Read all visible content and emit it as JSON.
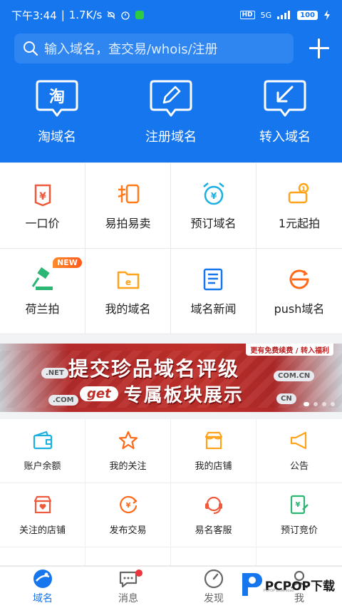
{
  "status_bar": {
    "time": "下午3:44",
    "speed": "1.7K/s",
    "hd": "HD",
    "network": "5G",
    "battery": "100"
  },
  "search": {
    "placeholder": "输入域名，查交易/whois/注册"
  },
  "quick_actions": [
    {
      "label": "淘域名",
      "icon": "tao-domain-icon"
    },
    {
      "label": "注册域名",
      "icon": "pencil-register-icon"
    },
    {
      "label": "转入域名",
      "icon": "transfer-in-icon"
    }
  ],
  "features": [
    {
      "label": "一口价",
      "icon": "price-tag-icon"
    },
    {
      "label": "易拍易卖",
      "icon": "auction-card-icon"
    },
    {
      "label": "预订域名",
      "icon": "alarm-clock-icon"
    },
    {
      "label": "1元起拍",
      "icon": "coin-stack-icon"
    },
    {
      "label": "荷兰拍",
      "icon": "gavel-icon",
      "badge": "NEW"
    },
    {
      "label": "我的域名",
      "icon": "folder-e-icon"
    },
    {
      "label": "域名新闻",
      "icon": "news-icon"
    },
    {
      "label": "push域名",
      "icon": "push-e-icon"
    }
  ],
  "banner": {
    "top_text": "更有免费续费 / 转入福利",
    "title": "提交珍品域名评级",
    "pill": "get",
    "subtitle": "专属板块展示",
    "tags": [
      ".NET",
      ".COM",
      "COM.CN",
      "CN"
    ]
  },
  "services": [
    {
      "label": "账户余额",
      "icon": "wallet-icon"
    },
    {
      "label": "我的关注",
      "icon": "star-icon"
    },
    {
      "label": "我的店铺",
      "icon": "shop-icon"
    },
    {
      "label": "公告",
      "icon": "megaphone-icon"
    },
    {
      "label": "关注的店铺",
      "icon": "followed-shop-icon"
    },
    {
      "label": "发布交易",
      "icon": "publish-trade-icon"
    },
    {
      "label": "易名客服",
      "icon": "headset-icon"
    },
    {
      "label": "预订竞价",
      "icon": "bid-doc-icon"
    }
  ],
  "nav": [
    {
      "label": "域名",
      "icon": "globe-icon",
      "active": true
    },
    {
      "label": "消息",
      "icon": "chat-icon"
    },
    {
      "label": "发现",
      "icon": "compass-icon"
    },
    {
      "label": "我",
      "icon": "user-icon"
    }
  ],
  "watermark": {
    "text": "PCPOP下载",
    "sub": "PCPOP Download"
  },
  "colors": {
    "brand_blue": "#1676ee",
    "accent_orange": "#ff6a1a",
    "badge_red": "#f0323c"
  }
}
